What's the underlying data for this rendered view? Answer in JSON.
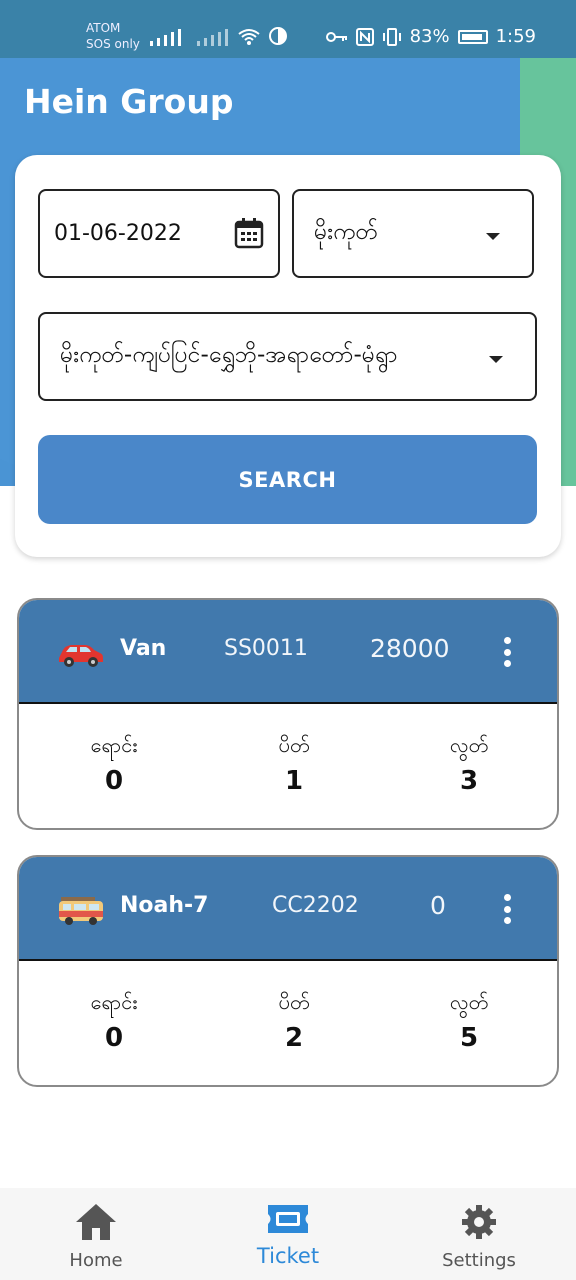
{
  "status_bar": {
    "carrier_line1": "ATOM",
    "carrier_line2": "SOS only",
    "battery": "83%",
    "time": "1:59"
  },
  "app": {
    "title": "Hein Group"
  },
  "search": {
    "date": "01-06-2022",
    "town": "မိုးကုတ်",
    "route": "မိုးကုတ်-ကျပ်ပြင်-ရွှေဘို-အရာတော်-မုံရွာ",
    "button_label": "SEARCH"
  },
  "vehicles": [
    {
      "icon": "car-icon",
      "name": "Van",
      "code": "SS0011",
      "price": "28000",
      "stats": [
        {
          "label": "ရောင်း",
          "value": "0"
        },
        {
          "label": "ပိတ်",
          "value": "1"
        },
        {
          "label": "လွတ်",
          "value": "3"
        }
      ]
    },
    {
      "icon": "bus-icon",
      "name": "Noah-7",
      "code": "CC2202",
      "price": "0",
      "stats": [
        {
          "label": "ရောင်း",
          "value": "0"
        },
        {
          "label": "ပိတ်",
          "value": "2"
        },
        {
          "label": "လွတ်",
          "value": "5"
        }
      ]
    }
  ],
  "nav": {
    "items": [
      {
        "label": "Home",
        "icon": "home-icon"
      },
      {
        "label": "Ticket",
        "icon": "ticket-icon",
        "active": true
      },
      {
        "label": "Settings",
        "icon": "gear-icon"
      }
    ]
  },
  "colors": {
    "header_blue": "#4a94d4",
    "header_green": "#67c49c",
    "card_header": "#4179ad",
    "button": "#4a87c9",
    "nav_active": "#2d89d8"
  }
}
